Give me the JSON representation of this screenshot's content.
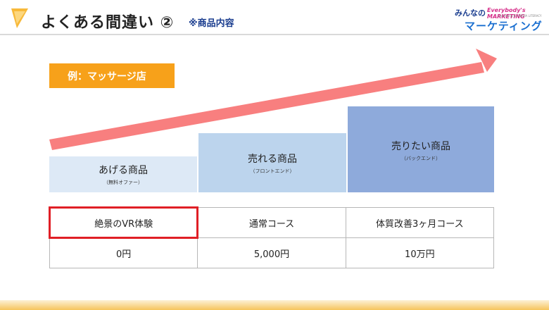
{
  "header": {
    "title": "よくある間違い ②",
    "subtitle": "※商品内容"
  },
  "logo": {
    "line1_a": "みんなの",
    "line1_b": "Everybody's MARKETING",
    "line1_sub": "marketing for MEDIA LITERACY",
    "line2": "マーケティング"
  },
  "example_label": "例：マッサージ店",
  "steps": [
    {
      "title": "あげる商品",
      "sub": "（無料オファー）"
    },
    {
      "title": "売れる商品",
      "sub": "（フロントエンド）"
    },
    {
      "title": "売りたい商品",
      "sub": "（バックエンド）"
    }
  ],
  "table": {
    "row1": [
      "絶景のVR体験",
      "通常コース",
      "体質改善3ヶ月コース"
    ],
    "row2": [
      "0円",
      "5,000円",
      "10万円"
    ]
  },
  "colors": {
    "accent": "#f7a11a",
    "arrow": "#f87f7f",
    "highlight": "#e01f26",
    "title_blue": "#1a3d8f"
  }
}
